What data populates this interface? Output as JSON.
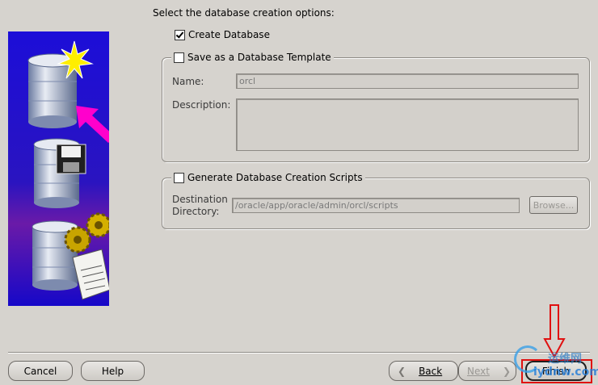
{
  "intro_text": "Select the database creation options:",
  "create_database": {
    "label": "Create Database",
    "checked": true
  },
  "template_group": {
    "label": "Save as a Database Template",
    "checked": false,
    "name_label": "Name:",
    "name_value": "orcl",
    "description_label": "Description:",
    "description_value": ""
  },
  "scripts_group": {
    "label": "Generate Database Creation Scripts",
    "checked": false,
    "dest_label_line1": "Destination",
    "dest_label_line2": "Directory:",
    "dest_value": "/oracle/app/oracle/admin/orcl/scripts",
    "browse_label": "Browse..."
  },
  "footer": {
    "cancel_label": "Cancel",
    "help_label": "Help",
    "back_label": "Back",
    "next_label": "Next",
    "finish_label": "Finish"
  },
  "watermark": {
    "text": "iydnw.com",
    "cn_text": "运维网"
  },
  "colors": {
    "background": "#d6d3ce",
    "illustration_bg": "#1a10c8",
    "arrow_pink": "#ff00cc",
    "annotation_red": "#e01010"
  }
}
